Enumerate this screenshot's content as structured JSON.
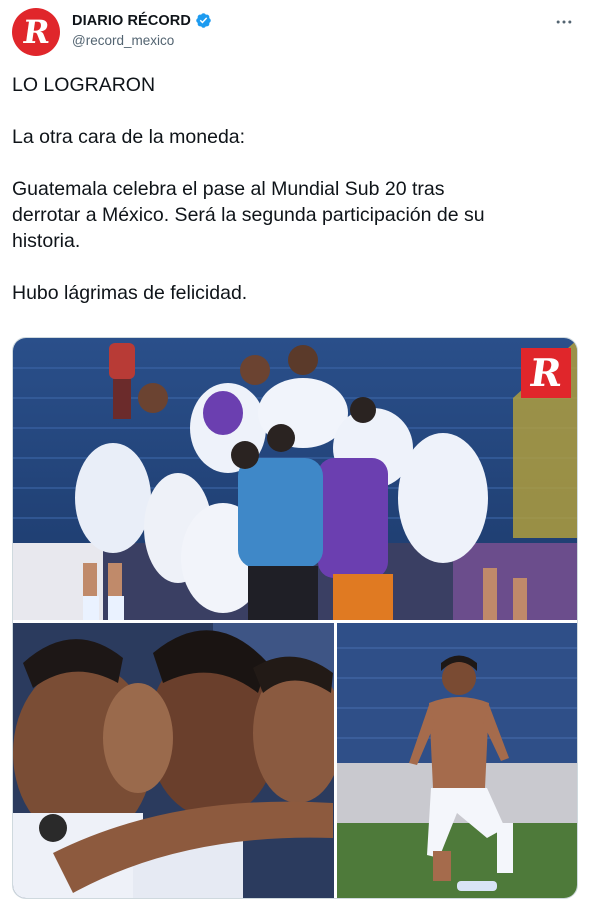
{
  "account": {
    "display_name": "DIARIO RÉCORD",
    "handle": "@record_mexico",
    "avatar_letter": "R",
    "verified": true
  },
  "tweet": {
    "text": "LO LOGRARON\n\nLa otra cara de la moneda:\n\nGuatemala celebra el pase al Mundial Sub 20 tras\nderrotar a México. Será la segunda participación de su\nhistoria.\n\nHubo lágrimas de felicidad."
  },
  "media": {
    "watermark_letter": "R",
    "photos": [
      {
        "description": "team-celebration"
      },
      {
        "description": "players-embracing"
      },
      {
        "description": "player-kneeling"
      }
    ]
  },
  "colors": {
    "brand_red": "#e0262b",
    "verified_blue": "#1d9bf0",
    "secondary_text": "#536471",
    "primary_text": "#0f1419"
  },
  "icons": {
    "more": "more-dots-icon",
    "verified": "verified-badge-icon"
  }
}
